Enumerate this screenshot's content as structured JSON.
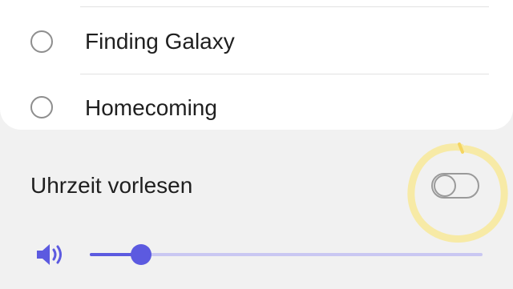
{
  "options": [
    {
      "label": "Finding Galaxy",
      "selected": false
    },
    {
      "label": "Homecoming",
      "selected": false
    }
  ],
  "read_time": {
    "label": "Uhrzeit vorlesen",
    "enabled": false
  },
  "volume": {
    "icon": "speaker-volume-icon",
    "level": 0.13,
    "accent_color": "#5c5ae0",
    "track_color": "#c9c7f2"
  },
  "annotation_color": "#f7eaa6"
}
